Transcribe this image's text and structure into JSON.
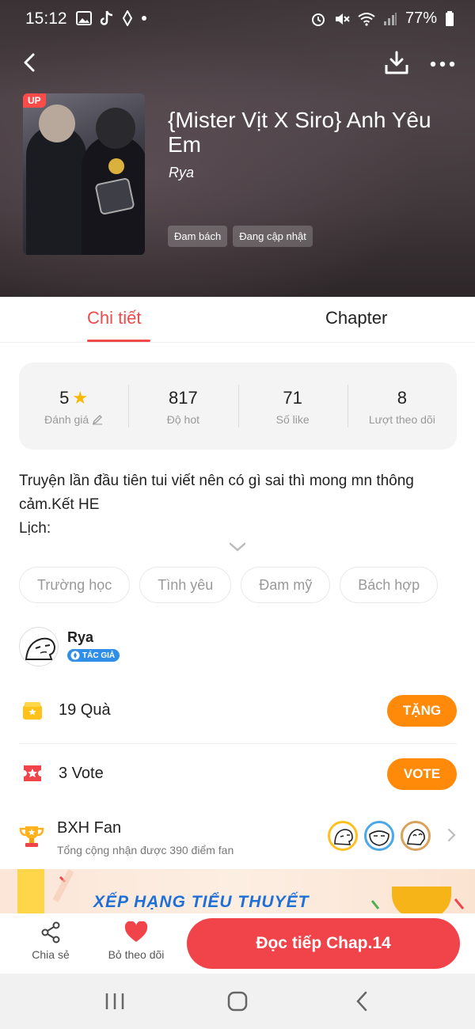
{
  "status_bar": {
    "time": "15:12",
    "battery": "77%"
  },
  "book": {
    "badge": "UP",
    "title": "{Mister Vịt X Siro} Anh Yêu Em",
    "author": "Rya",
    "genres": [
      "Đam bách",
      "Đang cập nhật"
    ]
  },
  "tabs": [
    {
      "label": "Chi tiết",
      "active": true
    },
    {
      "label": "Chapter",
      "active": false
    }
  ],
  "stats": [
    {
      "value": "5",
      "label": "Đánh giá",
      "icon": "star-icon"
    },
    {
      "value": "817",
      "label": "Độ hot"
    },
    {
      "value": "71",
      "label": "Số like"
    },
    {
      "value": "8",
      "label": "Lượt theo dõi"
    }
  ],
  "description": "Truyện lần đầu tiên tui viết nên có gì sai thì mong mn thông cảm.Kết HE\nLịch:",
  "tags": [
    "Trường học",
    "Tình yêu",
    "Đam mỹ",
    "Bách hợp"
  ],
  "author_info": {
    "name": "Rya",
    "badge": "TÁC GIẢ"
  },
  "actions": {
    "gift": {
      "text": "19 Quà",
      "button": "TẶNG"
    },
    "vote": {
      "text": "3 Vote",
      "button": "VOTE"
    }
  },
  "fan_ranking": {
    "title": "BXH Fan",
    "subtitle": "Tổng cộng nhận được 390 điểm fan"
  },
  "banner": {
    "text": "XẾP HẠNG TIỂU THUYẾT"
  },
  "bottom_bar": {
    "share": "Chia sẻ",
    "unfollow": "Bỏ theo dõi",
    "read_button": "Đọc tiếp Chap.14"
  },
  "colors": {
    "accent_red": "#f0434a",
    "orange": "#ff8a0a",
    "tab_active": "#f04a4a"
  }
}
